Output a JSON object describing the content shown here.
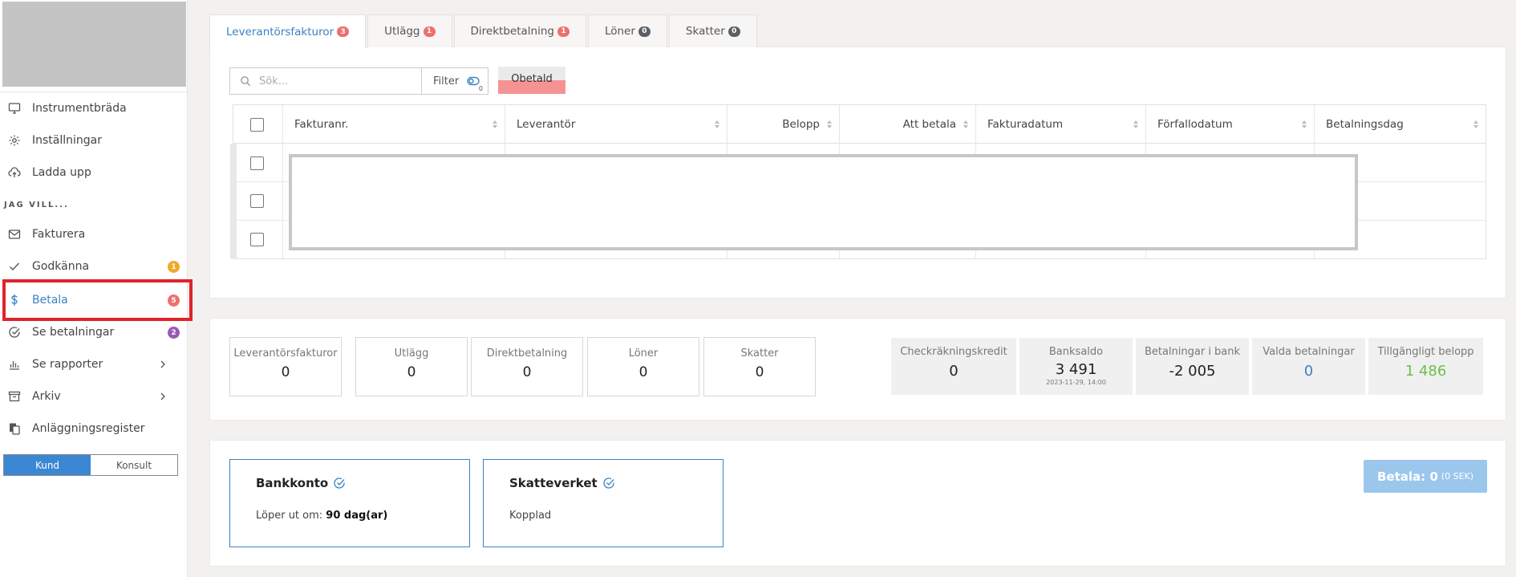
{
  "sidebar": {
    "items": [
      {
        "label": "Instrumentbräda",
        "icon": "monitor-icon"
      },
      {
        "label": "Inställningar",
        "icon": "gear-icon"
      },
      {
        "label": "Ladda upp",
        "icon": "upload-cloud-icon"
      },
      {
        "label": "Fakturera",
        "icon": "mail-icon"
      },
      {
        "label": "Godkänna",
        "icon": "check-icon",
        "badge": "1",
        "badge_color": "#f0a92e"
      },
      {
        "label": "Betala",
        "icon": "dollar-icon",
        "badge": "5",
        "badge_color": "#ef6f6f"
      },
      {
        "label": "Se betalningar",
        "icon": "check-circle-icon",
        "badge": "2",
        "badge_color": "#9b59b6"
      },
      {
        "label": "Se rapporter",
        "icon": "bar-chart-icon"
      },
      {
        "label": "Arkiv",
        "icon": "archive-icon"
      },
      {
        "label": "Anläggningsregister",
        "icon": "files-icon"
      }
    ],
    "section_label": "JAG VILL...",
    "toggle": {
      "on": "Kund",
      "off": "Konsult"
    }
  },
  "tabs": [
    {
      "label": "Leverantörsfakturor",
      "count": "3"
    },
    {
      "label": "Utlägg",
      "count": "1"
    },
    {
      "label": "Direktbetalning",
      "count": "1"
    },
    {
      "label": "Löner",
      "count": "0"
    },
    {
      "label": "Skatter",
      "count": "0"
    }
  ],
  "toolbar": {
    "search_placeholder": "Sök...",
    "filter_label": "Filter",
    "filter_count": "0",
    "status_chip": "Obetald"
  },
  "table": {
    "columns": [
      "Fakturanr.",
      "Leverantör",
      "Belopp",
      "Att betala",
      "Fakturadatum",
      "Förfallodatum",
      "Betalningsdag"
    ]
  },
  "summary": [
    {
      "label": "Leverantörsfakturor",
      "value": "0"
    },
    {
      "label": "Utlägg",
      "value": "0"
    },
    {
      "label": "Direktbetalning",
      "value": "0"
    },
    {
      "label": "Löner",
      "value": "0"
    },
    {
      "label": "Skatter",
      "value": "0"
    }
  ],
  "balances": [
    {
      "label": "Checkräkningskredit",
      "value": "0",
      "color": "#222"
    },
    {
      "label": "Banksaldo",
      "value": "3 491",
      "sub": "2023-11-29, 14:00",
      "color": "#222"
    },
    {
      "label": "Betalningar i bank",
      "value": "-2 005",
      "color": "#222"
    },
    {
      "label": "Valda betalningar",
      "value": "0",
      "color": "#3b82c4"
    },
    {
      "label": "Tillgängligt belopp",
      "value": "1 486",
      "color": "#6abf4b"
    }
  ],
  "connections": [
    {
      "title": "Bankkonto",
      "desc_prefix": "Löper ut om: ",
      "desc_bold": "90 dag(ar)"
    },
    {
      "title": "Skatteverket",
      "desc_prefix": "Kopplad",
      "desc_bold": ""
    }
  ],
  "pay_button": {
    "label": "Betala: 0",
    "sub": "(0 SEK)"
  }
}
